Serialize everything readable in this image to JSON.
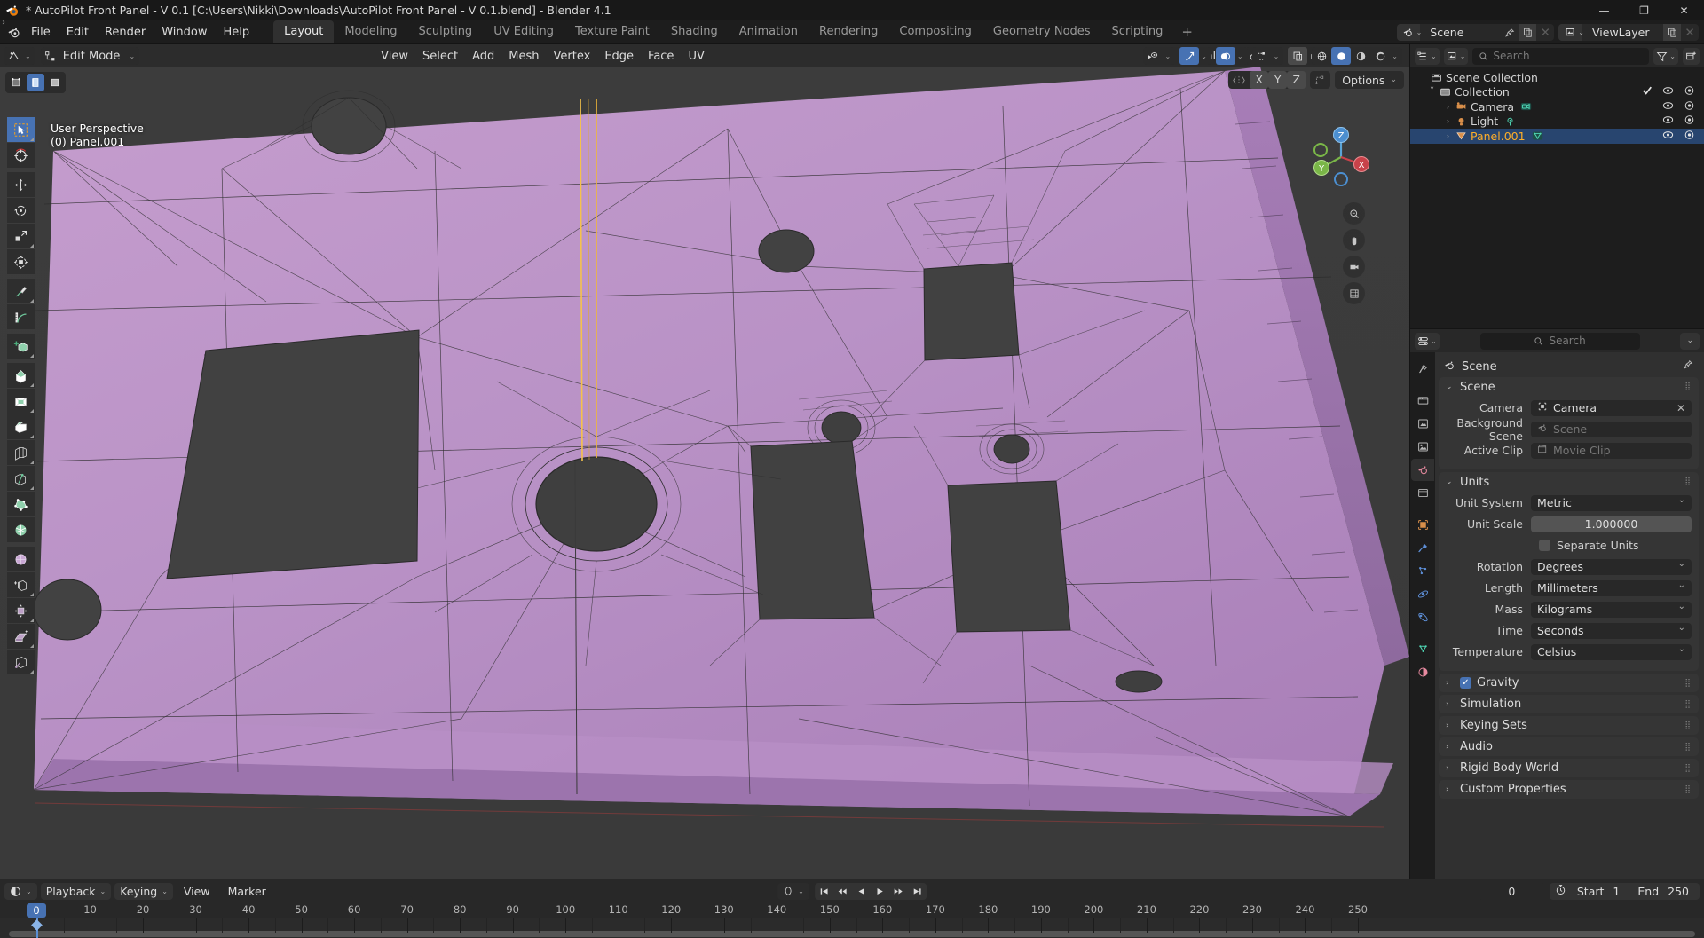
{
  "window": {
    "title": "* AutoPilot Front Panel - V 0.1 [C:\\Users\\Nikki\\Downloads\\AutoPilot Front Panel - V 0.1.blend] - Blender 4.1",
    "minimize": "—",
    "maximize": "❐",
    "close": "✕"
  },
  "menubar": {
    "items": [
      "File",
      "Edit",
      "Render",
      "Window",
      "Help"
    ],
    "workspaces": [
      {
        "label": "Layout",
        "active": true
      },
      {
        "label": "Modeling",
        "active": false
      },
      {
        "label": "Sculpting",
        "active": false
      },
      {
        "label": "UV Editing",
        "active": false
      },
      {
        "label": "Texture Paint",
        "active": false
      },
      {
        "label": "Shading",
        "active": false
      },
      {
        "label": "Animation",
        "active": false
      },
      {
        "label": "Rendering",
        "active": false
      },
      {
        "label": "Compositing",
        "active": false
      },
      {
        "label": "Geometry Nodes",
        "active": false
      },
      {
        "label": "Scripting",
        "active": false
      }
    ],
    "add_workspace": "+",
    "scene": {
      "label": "Scene",
      "icon": "scene-icon",
      "pin": "pin-icon",
      "copy": "new-scene-icon",
      "remove": "x-icon"
    },
    "viewlayer": {
      "label": "ViewLayer",
      "icon": "viewlayer-icon",
      "copy": "new-viewlayer-icon",
      "remove": "x-icon"
    }
  },
  "viewport": {
    "mode": "Edit Mode",
    "menus": [
      "View",
      "Select",
      "Add",
      "Mesh",
      "Vertex",
      "Edge",
      "Face",
      "UV"
    ],
    "transform_orientation": "Global",
    "options_label": "Options",
    "proportional_axes": [
      "X",
      "Y",
      "Z"
    ],
    "overlay": {
      "line1": "User Perspective",
      "line2": "(0) Panel.001"
    },
    "gizmo_axes": {
      "x": "X",
      "y": "Y",
      "z": "Z"
    },
    "select_modes": [
      {
        "name": "vertex-select-mode",
        "on": false
      },
      {
        "name": "edge-select-mode",
        "on": true
      },
      {
        "name": "face-select-mode",
        "on": false
      }
    ],
    "tools": [
      {
        "name": "tweak-tool",
        "active": true
      },
      {
        "name": "select-box-tool",
        "active": false
      },
      {
        "name": "move-tool",
        "active": false
      },
      {
        "name": "rotate-tool",
        "active": false
      },
      {
        "name": "scale-tool",
        "active": false
      },
      {
        "name": "transform-tool",
        "active": false
      },
      {
        "name": "annotate-tool",
        "active": false
      },
      {
        "name": "measure-tool",
        "active": false
      },
      {
        "name": "add-cube-tool",
        "active": false
      },
      {
        "name": "extrude-region-tool",
        "active": false
      },
      {
        "name": "inset-faces-tool",
        "active": false
      },
      {
        "name": "bevel-tool",
        "active": false
      },
      {
        "name": "loop-cut-tool",
        "active": false
      },
      {
        "name": "knife-tool",
        "active": false
      },
      {
        "name": "poly-build-tool",
        "active": false
      },
      {
        "name": "spin-tool",
        "active": false
      },
      {
        "name": "smooth-tool",
        "active": false
      },
      {
        "name": "edge-slide-tool",
        "active": false
      },
      {
        "name": "shrink-fatten-tool",
        "active": false
      },
      {
        "name": "shear-tool",
        "active": false
      },
      {
        "name": "rip-region-tool",
        "active": false
      }
    ],
    "header_right_icons": [
      "visibility-icon",
      "snap-icon",
      "proportional-editing-icon",
      "show-gizmo-icon",
      "show-overlays-icon",
      "xray-icon",
      "shading-wireframe-icon",
      "shading-solid-icon",
      "shading-material-icon",
      "shading-rendered-icon"
    ],
    "colors": {
      "mesh_fill": "#b98fc4",
      "selected_edge": "#f5c24b",
      "background": "#3b3b3b"
    }
  },
  "outliner": {
    "search_placeholder": "Search",
    "display_mode_icon": "outliner-display-mode-icon",
    "filter_icon": "filter-icon",
    "new_collection_icon": "new-collection-icon",
    "rows": [
      {
        "name": "Scene Collection",
        "icon": "scene-collection-icon",
        "indent": 0,
        "disclosure": "",
        "selected": false,
        "checkbox": false,
        "eye": false,
        "camera": false,
        "data_icon": ""
      },
      {
        "name": "Collection",
        "icon": "collection-icon",
        "indent": 1,
        "disclosure": "˅",
        "selected": false,
        "checkbox": true,
        "eye": true,
        "camera": true,
        "data_icon": ""
      },
      {
        "name": "Camera",
        "icon": "camera-object-icon",
        "indent": 2,
        "disclosure": "›",
        "selected": false,
        "checkbox": false,
        "eye": true,
        "camera": true,
        "data_icon": "camera-data-icon"
      },
      {
        "name": "Light",
        "icon": "light-object-icon",
        "indent": 2,
        "disclosure": "›",
        "selected": false,
        "checkbox": false,
        "eye": true,
        "camera": true,
        "data_icon": "light-data-icon"
      },
      {
        "name": "Panel.001",
        "icon": "mesh-object-icon",
        "indent": 2,
        "disclosure": "›",
        "selected": true,
        "checkbox": false,
        "eye": true,
        "camera": true,
        "data_icon": "mesh-data-icon"
      }
    ]
  },
  "properties": {
    "search_placeholder": "Search",
    "editor_icon": "properties-editor-icon",
    "tabs": [
      {
        "name": "tool-tab",
        "icon": "tool-icon",
        "active": false
      },
      {
        "name": "render-tab",
        "icon": "render-icon",
        "active": false
      },
      {
        "name": "output-tab",
        "icon": "output-icon",
        "active": false
      },
      {
        "name": "view-layer-tab",
        "icon": "view-layer-icon",
        "active": false
      },
      {
        "name": "scene-tab",
        "icon": "scene-icon",
        "active": true
      },
      {
        "name": "world-tab",
        "icon": "world-icon",
        "active": false
      },
      {
        "name": "collection-tab",
        "icon": "collection-icon",
        "active": false
      },
      {
        "name": "object-tab",
        "icon": "object-icon",
        "active": false
      },
      {
        "name": "modifier-tab",
        "icon": "wrench-icon",
        "active": false
      },
      {
        "name": "particles-tab",
        "icon": "particles-icon",
        "active": false
      },
      {
        "name": "physics-tab",
        "icon": "physics-icon",
        "active": false
      },
      {
        "name": "constraints-tab",
        "icon": "constraints-icon",
        "active": false
      },
      {
        "name": "data-tab",
        "icon": "mesh-data-icon",
        "active": false
      },
      {
        "name": "material-tab",
        "icon": "material-icon",
        "active": false
      }
    ],
    "breadcrumb": "Scene",
    "scene_panel": {
      "title": "Scene",
      "rows": [
        {
          "label": "Camera",
          "value": "Camera",
          "icon": "camera-data-icon",
          "type": "id",
          "clearable": true
        },
        {
          "label": "Background Scene",
          "value": "Scene",
          "icon": "scene-icon",
          "type": "id-empty",
          "clearable": false
        },
        {
          "label": "Active Clip",
          "value": "Movie Clip",
          "icon": "clip-icon",
          "type": "id-empty",
          "clearable": false
        }
      ]
    },
    "units_panel": {
      "title": "Units",
      "unit_system_label": "Unit System",
      "unit_system_value": "Metric",
      "unit_scale_label": "Unit Scale",
      "unit_scale_value": "1.000000",
      "separate_units_label": "Separate Units",
      "separate_units_checked": false,
      "rows": [
        {
          "label": "Rotation",
          "value": "Degrees"
        },
        {
          "label": "Length",
          "value": "Millimeters"
        },
        {
          "label": "Mass",
          "value": "Kilograms"
        },
        {
          "label": "Time",
          "value": "Seconds"
        },
        {
          "label": "Temperature",
          "value": "Celsius"
        }
      ]
    },
    "collapsed_panels": [
      {
        "label": "Gravity",
        "checkbox": true,
        "checked": true
      },
      {
        "label": "Simulation",
        "checkbox": false,
        "checked": false
      },
      {
        "label": "Keying Sets",
        "checkbox": false,
        "checked": false
      },
      {
        "label": "Audio",
        "checkbox": false,
        "checked": false
      },
      {
        "label": "Rigid Body World",
        "checkbox": false,
        "checked": false
      },
      {
        "label": "Custom Properties",
        "checkbox": false,
        "checked": false
      }
    ]
  },
  "timeline": {
    "editor_icon": "timeline-editor-icon",
    "menus": [
      "Playback",
      "Keying",
      "View",
      "Marker"
    ],
    "sync_mode_icon": "sync-icon",
    "playback_buttons": [
      "jump-to-start-icon",
      "jump-prev-keyframe-icon",
      "play-reverse-icon",
      "play-icon",
      "jump-next-keyframe-icon",
      "jump-to-end-icon"
    ],
    "current_frame": "0",
    "start_label": "Start",
    "start_value": "1",
    "end_label": "End",
    "end_value": "250",
    "playhead_frame": "0",
    "ticks": [
      0,
      10,
      20,
      30,
      40,
      50,
      60,
      70,
      80,
      90,
      100,
      110,
      120,
      130,
      140,
      150,
      160,
      170,
      180,
      190,
      200,
      210,
      220,
      230,
      240,
      250
    ]
  }
}
